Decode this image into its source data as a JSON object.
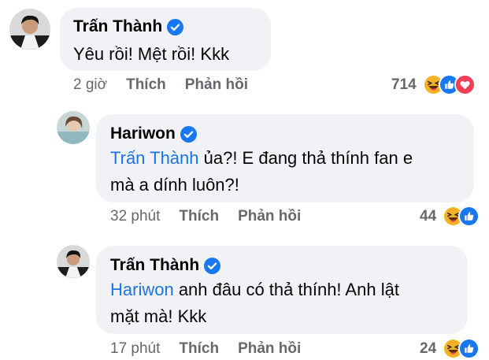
{
  "comments": [
    {
      "author": "Trấn Thành",
      "mention": "",
      "text_line1": "Yêu rồi! Mệt rồi! Kkk",
      "text_line2": "",
      "time": "2 giờ",
      "like_label": "Thích",
      "reply_label": "Phản hồi",
      "reaction_count": "714",
      "reactions": [
        "haha-icon",
        "like-icon",
        "love-icon"
      ]
    },
    {
      "author": "Hariwon",
      "mention": "Trấn Thành",
      "text_line1": " ủa?! E đang thả thính fan e",
      "text_line2": "mà a dính luôn?!",
      "time": "32 phút",
      "like_label": "Thích",
      "reply_label": "Phản hồi",
      "reaction_count": "44",
      "reactions": [
        "haha-icon",
        "like-icon"
      ]
    },
    {
      "author": "Trấn Thành",
      "mention": "Hariwon",
      "text_line1": " anh đâu có thả thính! Anh lật",
      "text_line2": "mặt mà! Kkk",
      "time": "17 phút",
      "like_label": "Thích",
      "reply_label": "Phản hồi",
      "reaction_count": "24",
      "reactions": [
        "haha-icon",
        "like-icon"
      ]
    }
  ],
  "colors": {
    "mention": "#1b74e4",
    "bubble": "#f0f2f5",
    "meta": "#65676b",
    "verified": "#1877f2"
  }
}
